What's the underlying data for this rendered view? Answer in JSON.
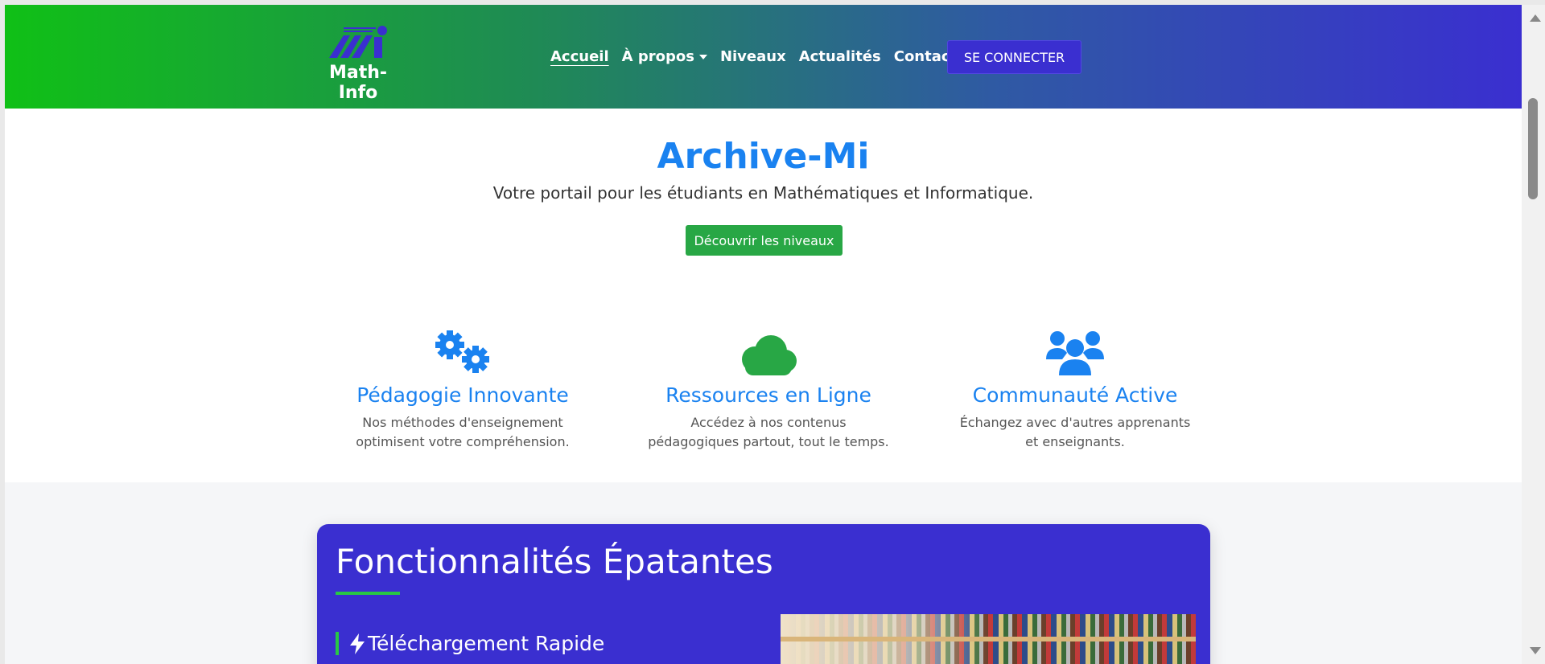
{
  "header": {
    "logo_text": "Math-Info",
    "nav": [
      {
        "label": "Accueil"
      },
      {
        "label": "À propos"
      },
      {
        "label": "Niveaux"
      },
      {
        "label": "Actualités"
      },
      {
        "label": "Contacts"
      }
    ],
    "login_label": "SE CONNECTER"
  },
  "hero": {
    "title": "Archive-Mi",
    "subtitle": "Votre portail pour les étudiants en Mathématiques et Informatique.",
    "cta_label": "Découvrir les niveaux"
  },
  "features": [
    {
      "icon": "gears-icon",
      "title": "Pédagogie Innovante",
      "desc_line1": "Nos méthodes d'enseignement",
      "desc_line2": "optimisent votre compréhension."
    },
    {
      "icon": "cloud-icon",
      "title": "Ressources en Ligne",
      "desc_line1": "Accédez à nos contenus",
      "desc_line2": "pédagogiques partout, tout le temps."
    },
    {
      "icon": "users-icon",
      "title": "Communauté Active",
      "desc_line1": "Échangez avec d'autres apprenants",
      "desc_line2": "et enseignants."
    }
  ],
  "showcase": {
    "title": "Fonctionnalités Épatantes",
    "items": [
      {
        "icon": "bolt-icon",
        "label": "Téléchargement Rapide"
      }
    ]
  },
  "colors": {
    "header_gradient_start": "#10c016",
    "header_gradient_end": "#3a2fd0",
    "accent_blue": "#1a82f0",
    "accent_green": "#28a745",
    "card_purple": "#3a2fd0"
  }
}
